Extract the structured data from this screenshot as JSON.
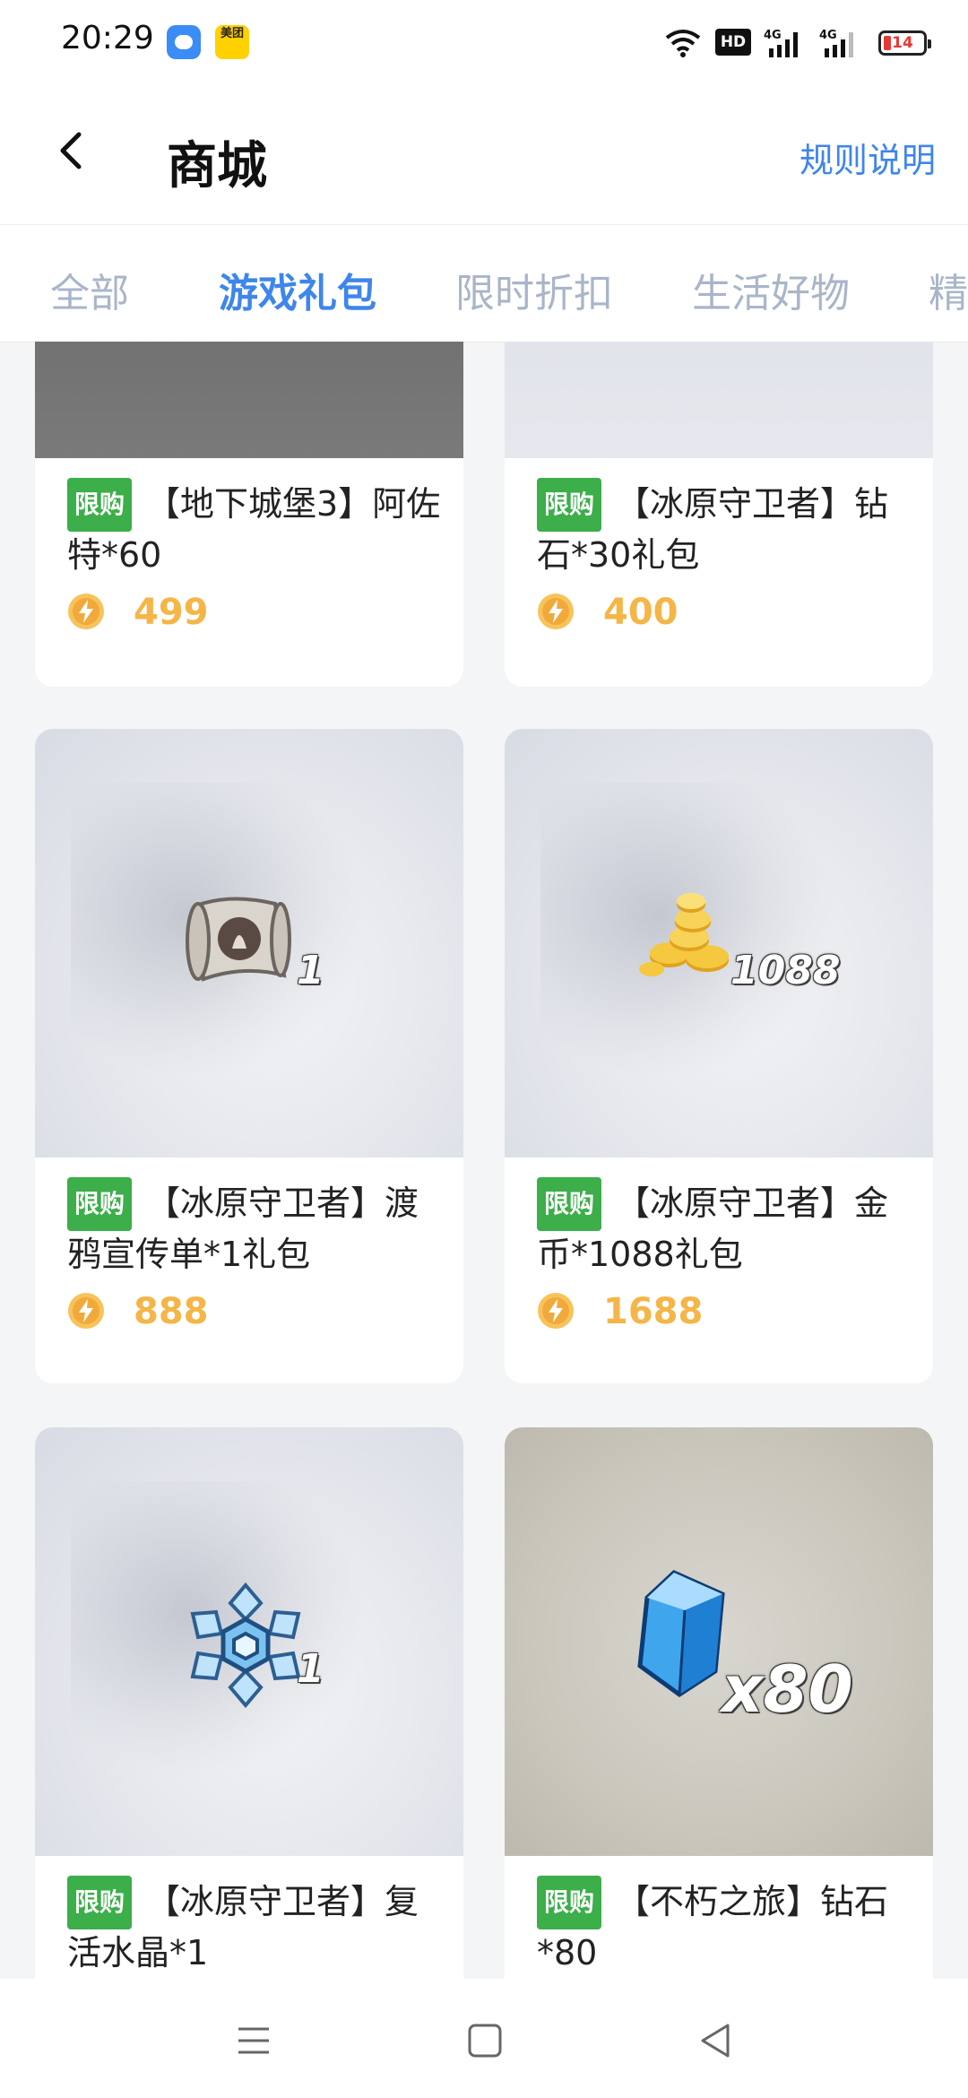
{
  "status_bar": {
    "time": "20:29",
    "app2_label": "美团",
    "hd_label": "HD",
    "signal1_label": "4G",
    "signal2_label": "4G",
    "battery": "14"
  },
  "header": {
    "title": "商城",
    "rules_link": "规则说明"
  },
  "tabs": [
    {
      "label": "全部"
    },
    {
      "label": "游戏礼包"
    },
    {
      "label": "限时折扣"
    },
    {
      "label": "生活好物"
    },
    {
      "label": "精"
    }
  ],
  "active_tab": "游戏礼包",
  "badge_label": "限购",
  "products": [
    {
      "name": "【地下城堡3】阿佐特*60",
      "price": "499",
      "quantity": ""
    },
    {
      "name": "【冰原守卫者】钻石*30礼包",
      "price": "400",
      "quantity": ""
    },
    {
      "name": "【冰原守卫者】渡鸦宣传单*1礼包",
      "price": "888",
      "quantity": "1"
    },
    {
      "name": "【冰原守卫者】金币*1088礼包",
      "price": "1688",
      "quantity": "1088"
    },
    {
      "name": "【冰原守卫者】复活水晶*1",
      "price": "",
      "quantity": "1"
    },
    {
      "name": "【不朽之旅】钻石*80",
      "price": "",
      "quantity": "x80"
    }
  ],
  "colors": {
    "accent": "#3e86ea",
    "badge": "#3cae4a",
    "price": "#f5b547",
    "tab_inactive": "#a9b5c9"
  }
}
